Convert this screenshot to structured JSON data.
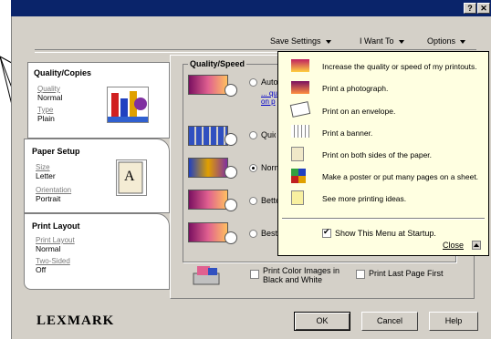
{
  "titlebar": {
    "help_btn": "?",
    "close_btn": "✕"
  },
  "menu": {
    "save_settings": "Save Settings",
    "i_want_to": "I Want To",
    "options": "Options"
  },
  "left": {
    "quality": {
      "title": "Quality/Copies",
      "quality_link": "Quality",
      "quality_value": "Normal",
      "type_link": "Type",
      "type_value": "Plain"
    },
    "paper": {
      "title": "Paper Setup",
      "size_link": "Size",
      "size_value": "Letter",
      "orientation_link": "Orientation",
      "orientation_value": "Portrait"
    },
    "layout": {
      "title": "Print Layout",
      "layout_link": "Print Layout",
      "layout_value": "Normal",
      "twosided_link": "Two-Sided",
      "twosided_value": "Off"
    }
  },
  "main": {
    "group_title": "Quality/Speed",
    "options": [
      {
        "label": "Auto",
        "selected": false
      },
      {
        "label": "Quick",
        "selected": false
      },
      {
        "label": "Normal",
        "selected": true
      },
      {
        "label": "Better",
        "selected": false
      },
      {
        "label": "Best",
        "selected": false
      }
    ],
    "auto_link": "... qu on p",
    "print_color_bw": "Print Color Images in Black and White",
    "print_last_page": "Print Last Page First"
  },
  "popup": {
    "items": [
      "Increase the quality or speed of my printouts.",
      "Print a photograph.",
      "Print on an envelope.",
      "Print a banner.",
      "Print on both sides of the paper.",
      "Make a poster or put many pages on a sheet.",
      "See more printing ideas."
    ],
    "show_menu": "Show This Menu at Startup.",
    "close": "Close"
  },
  "brand": "LEXMARK",
  "buttons": {
    "ok": "OK",
    "cancel": "Cancel",
    "help": "Help"
  }
}
